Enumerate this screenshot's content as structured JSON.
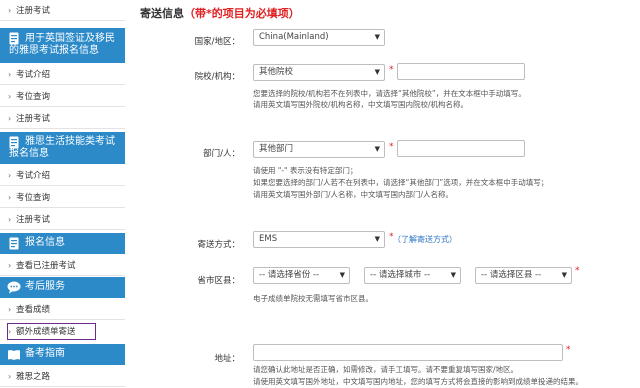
{
  "sidebar": {
    "items": [
      {
        "label": "注册考试"
      },
      {
        "label": "考试介绍"
      },
      {
        "label": "考位查询"
      },
      {
        "label": "注册考试"
      },
      {
        "label": "考试介绍"
      },
      {
        "label": "考位查询"
      },
      {
        "label": "注册考试"
      },
      {
        "label": "查看已注册考试"
      },
      {
        "label": "查看成绩"
      },
      {
        "label": "额外成绩单寄送"
      },
      {
        "label": "雅思之路"
      }
    ],
    "headers": [
      {
        "label": "用于英国签证及移民的雅思考试报名信息"
      },
      {
        "label": "雅思生活技能类考试报名信息"
      },
      {
        "label": "报名信息"
      },
      {
        "label": "考后服务"
      },
      {
        "label": "备考指南"
      }
    ],
    "accent": "#2c8ac9",
    "active_border": "#6b2c8f"
  },
  "form": {
    "title": "寄送信息",
    "title_note": "（带*的项目为必填项）",
    "country": {
      "label": "国家/地区：",
      "value": "China(Mainland)"
    },
    "institution": {
      "label": "院校/机构：",
      "value": "其他院校",
      "hint1": "您要选择的院校/机构若不在列表中，请选择“其他院校”，并在文本框中手动填写。",
      "hint2": "请用英文填写国外院校/机构名称，中文填写国内院校/机构名称。"
    },
    "department": {
      "label": "部门/人：",
      "value": "其他部门",
      "hint1": "请使用 \"-\" 表示没有特定部门；",
      "hint2": "如果您要选择的部门/人若不在列表中，请选择“其他部门”选项，并在文本框中手动填写；",
      "hint3": "请用英文填写国外部门/人名称，中文填写国内部门/人名称。"
    },
    "shipping": {
      "label": "寄送方式：",
      "value": "EMS",
      "link": "（了解寄送方式）"
    },
    "region": {
      "label": "省市区县：",
      "province": "-- 请选择省份 --",
      "city": "-- 请选择城市 --",
      "district": "-- 请选择区县 --",
      "hint": "电子成绩单院校无需填写省市区县。"
    },
    "address": {
      "label": "地址：",
      "hint1": "请您确认此地址是否正确，如需修改，请手工填写。请不要重复填写国家/地区。",
      "hint2": "请使用英文填写国外地址，中文填写国内地址，您的填写方式将会直接的影响到成绩单投递的结果。"
    },
    "required_mark": "*",
    "required_color": "#e02020"
  }
}
